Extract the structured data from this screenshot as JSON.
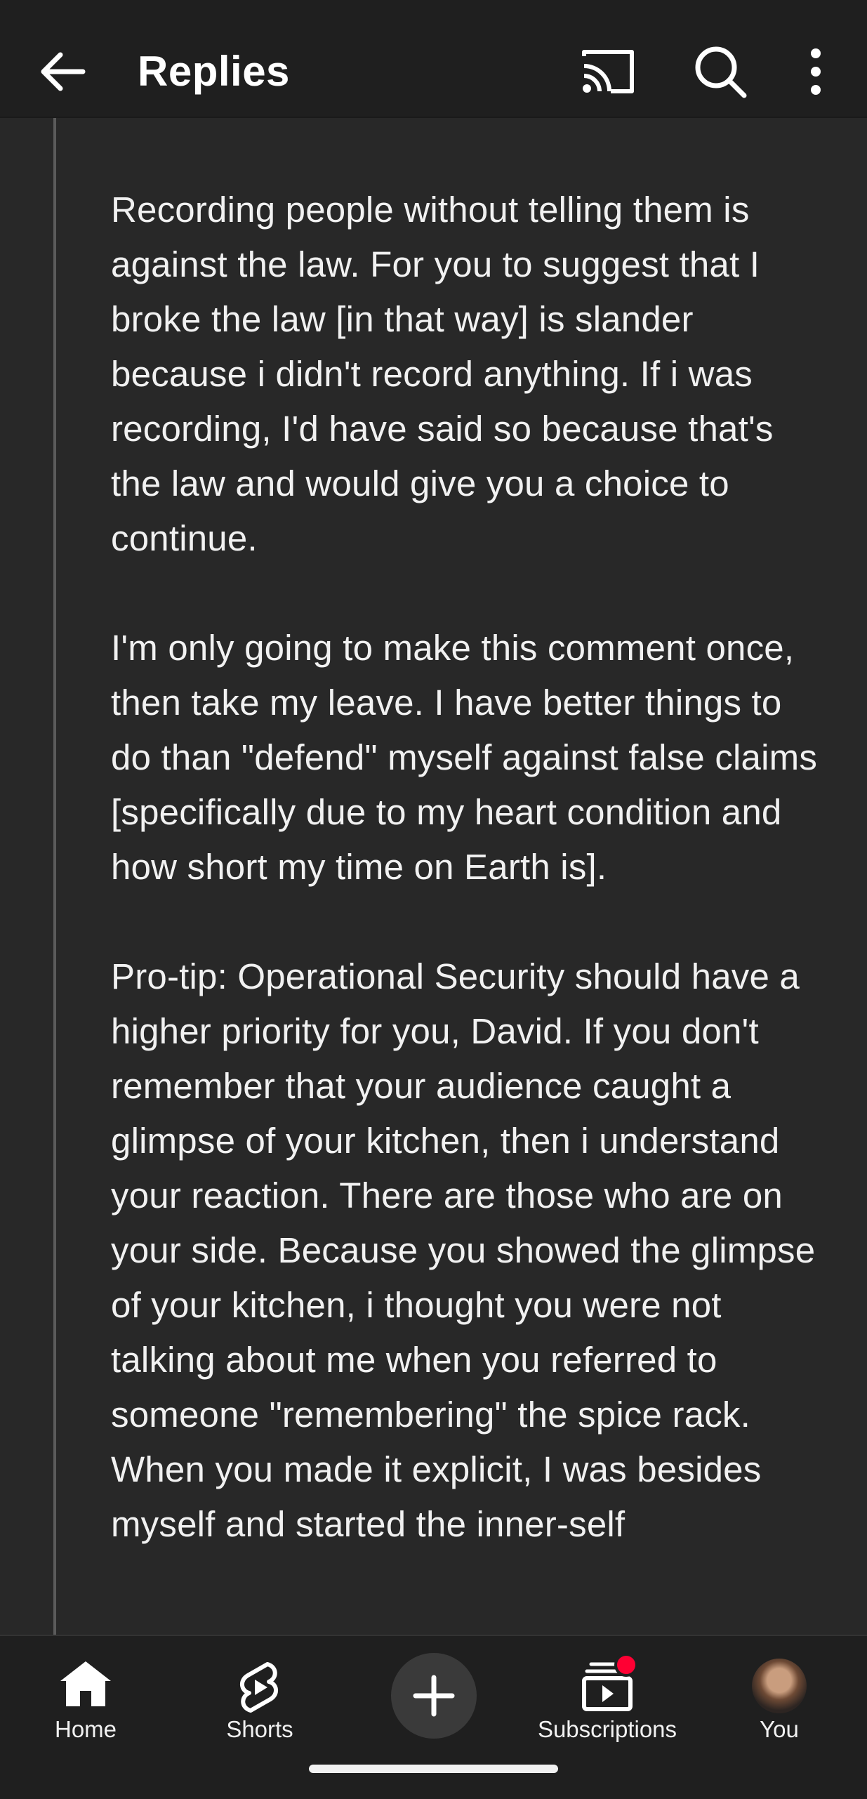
{
  "header": {
    "title": "Replies",
    "back_icon": "arrow-left-icon",
    "cast_icon": "cast-icon",
    "search_icon": "search-icon",
    "more_icon": "more-vertical-icon"
  },
  "comment": {
    "paragraphs": [
      "Recording people without telling them is against the law.  For you to suggest that I broke the law [in that way] is slander because i didn't record anything.  If i was recording, I'd have said so because that's the law and would give you a choice to continue.",
      "I'm only going to make this comment once, then take my leave.  I have better things to do than \"defend\" myself against false claims [specifically due to my heart condition and how short my time on Earth is].",
      "Pro-tip: Operational Security should have a higher priority for you, David.  If you don't remember that your audience caught a glimpse of your kitchen, then i understand your reaction.  There are those who are on your side.  Because you showed the glimpse of your kitchen, i thought you were not talking about me when you referred to someone \"remembering\" the spice rack.   When you made it explicit,  I was besides myself and started the inner-self"
    ]
  },
  "bottom_nav": {
    "items": [
      {
        "label": "Home",
        "icon": "home-icon"
      },
      {
        "label": "Shorts",
        "icon": "shorts-icon"
      },
      {
        "label": "",
        "icon": "create-plus-icon"
      },
      {
        "label": "Subscriptions",
        "icon": "subscriptions-icon"
      },
      {
        "label": "You",
        "icon": "avatar"
      }
    ]
  },
  "colors": {
    "background": "#282828",
    "bar": "#1f1f1f",
    "text": "#f1f1f1",
    "notification": "#ff0033"
  }
}
